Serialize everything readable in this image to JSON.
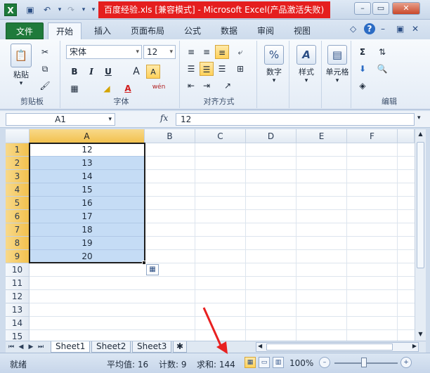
{
  "window": {
    "title": "百度经验.xls  [兼容模式] - Microsoft Excel(产品激活失败)",
    "app_icon_letter": "X"
  },
  "qat": {
    "save_glyph": "▣",
    "undo_glyph": "↶",
    "redo_glyph": "↷",
    "dropdown_glyph": "▾"
  },
  "window_controls": {
    "minimize_glyph": "–",
    "maximize_glyph": "▭",
    "close_glyph": "✕"
  },
  "tabs": [
    {
      "label": "文件"
    },
    {
      "label": "开始"
    },
    {
      "label": "插入"
    },
    {
      "label": "页面布局"
    },
    {
      "label": "公式"
    },
    {
      "label": "数据"
    },
    {
      "label": "审阅"
    },
    {
      "label": "视图"
    }
  ],
  "ribbon": {
    "clipboard": {
      "label": "剪贴板",
      "paste_label": "粘贴"
    },
    "font": {
      "label": "字体",
      "font_name": "宋体",
      "font_size": "12",
      "bold": "B",
      "italic": "I",
      "underline": "U",
      "grow": "A",
      "shrink": "A",
      "wen": "wén"
    },
    "alignment": {
      "label": "对齐方式"
    },
    "number": {
      "label": "数字"
    },
    "styles": {
      "label": "样式"
    },
    "cells": {
      "label": "单元格"
    },
    "editing": {
      "label": "编辑",
      "sigma": "Σ"
    }
  },
  "formula_bar": {
    "name_box": "A1",
    "fx": "fx",
    "value": "12"
  },
  "grid": {
    "columns": [
      "A",
      "B",
      "C",
      "D",
      "E",
      "F"
    ],
    "rows": [
      "1",
      "2",
      "3",
      "4",
      "5",
      "6",
      "7",
      "8",
      "9",
      "10",
      "11",
      "12",
      "13",
      "14",
      "15"
    ],
    "column_a_values": [
      "12",
      "13",
      "14",
      "15",
      "16",
      "17",
      "18",
      "19",
      "20"
    ]
  },
  "sheets": [
    {
      "name": "Sheet1",
      "active": true
    },
    {
      "name": "Sheet2",
      "active": false
    },
    {
      "name": "Sheet3",
      "active": false
    }
  ],
  "status": {
    "ready": "就绪",
    "average": "平均值: 16",
    "count": "计数: 9",
    "sum": "求和: 144",
    "zoom": "100%"
  },
  "colors": {
    "selection_fill": "#c5dcf5",
    "header_selected": "#f2c14e",
    "file_tab": "#1f7a3b",
    "title_highlight": "#e51e1e",
    "annotation": "#e82020"
  }
}
